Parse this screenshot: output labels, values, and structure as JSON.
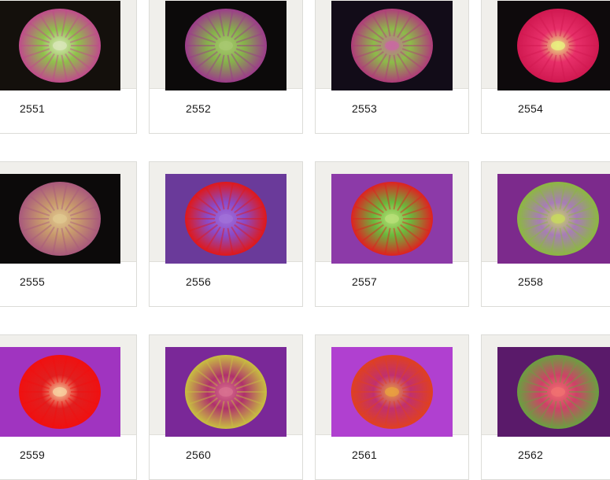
{
  "gallery": {
    "items": [
      {
        "id": "2551",
        "bg": "#14100c",
        "disc": [
          "#c04a8c",
          "#8fc24a",
          "#d8e6b8"
        ]
      },
      {
        "id": "2552",
        "bg": "#0c0a0a",
        "disc": [
          "#9c3a8a",
          "#86b24a",
          "#a8c870"
        ]
      },
      {
        "id": "2553",
        "bg": "#120c18",
        "disc": [
          "#b03a7a",
          "#8cbc48",
          "#c86aa0"
        ]
      },
      {
        "id": "2554",
        "bg": "#0e0a0c",
        "disc": [
          "#d01850",
          "#e8306a",
          "#e8f080"
        ]
      },
      {
        "id": "2555",
        "bg": "#0c0a0a",
        "disc": [
          "#a8587c",
          "#c89a6c",
          "#e0c890"
        ]
      },
      {
        "id": "2556",
        "bg": "#6a3a9a",
        "disc": [
          "#e01818",
          "#8a4ac8",
          "#a070d8"
        ]
      },
      {
        "id": "2557",
        "bg": "#8c3aa8",
        "disc": [
          "#e02020",
          "#6ab83c",
          "#b8e078"
        ]
      },
      {
        "id": "2558",
        "bg": "#7c2a8c",
        "disc": [
          "#8cb840",
          "#a87cb8",
          "#c8d860"
        ]
      },
      {
        "id": "2559",
        "bg": "#a034c0",
        "disc": [
          "#f01010",
          "#e02020",
          "#f8d0a0"
        ]
      },
      {
        "id": "2560",
        "bg": "#7a2898",
        "disc": [
          "#c8c040",
          "#b0306c",
          "#d87090"
        ]
      },
      {
        "id": "2561",
        "bg": "#b040d0",
        "disc": [
          "#e04020",
          "#c03070",
          "#e8a040"
        ]
      },
      {
        "id": "2562",
        "bg": "#5a1a6a",
        "disc": [
          "#6aa040",
          "#d04068",
          "#f07070"
        ]
      }
    ]
  }
}
